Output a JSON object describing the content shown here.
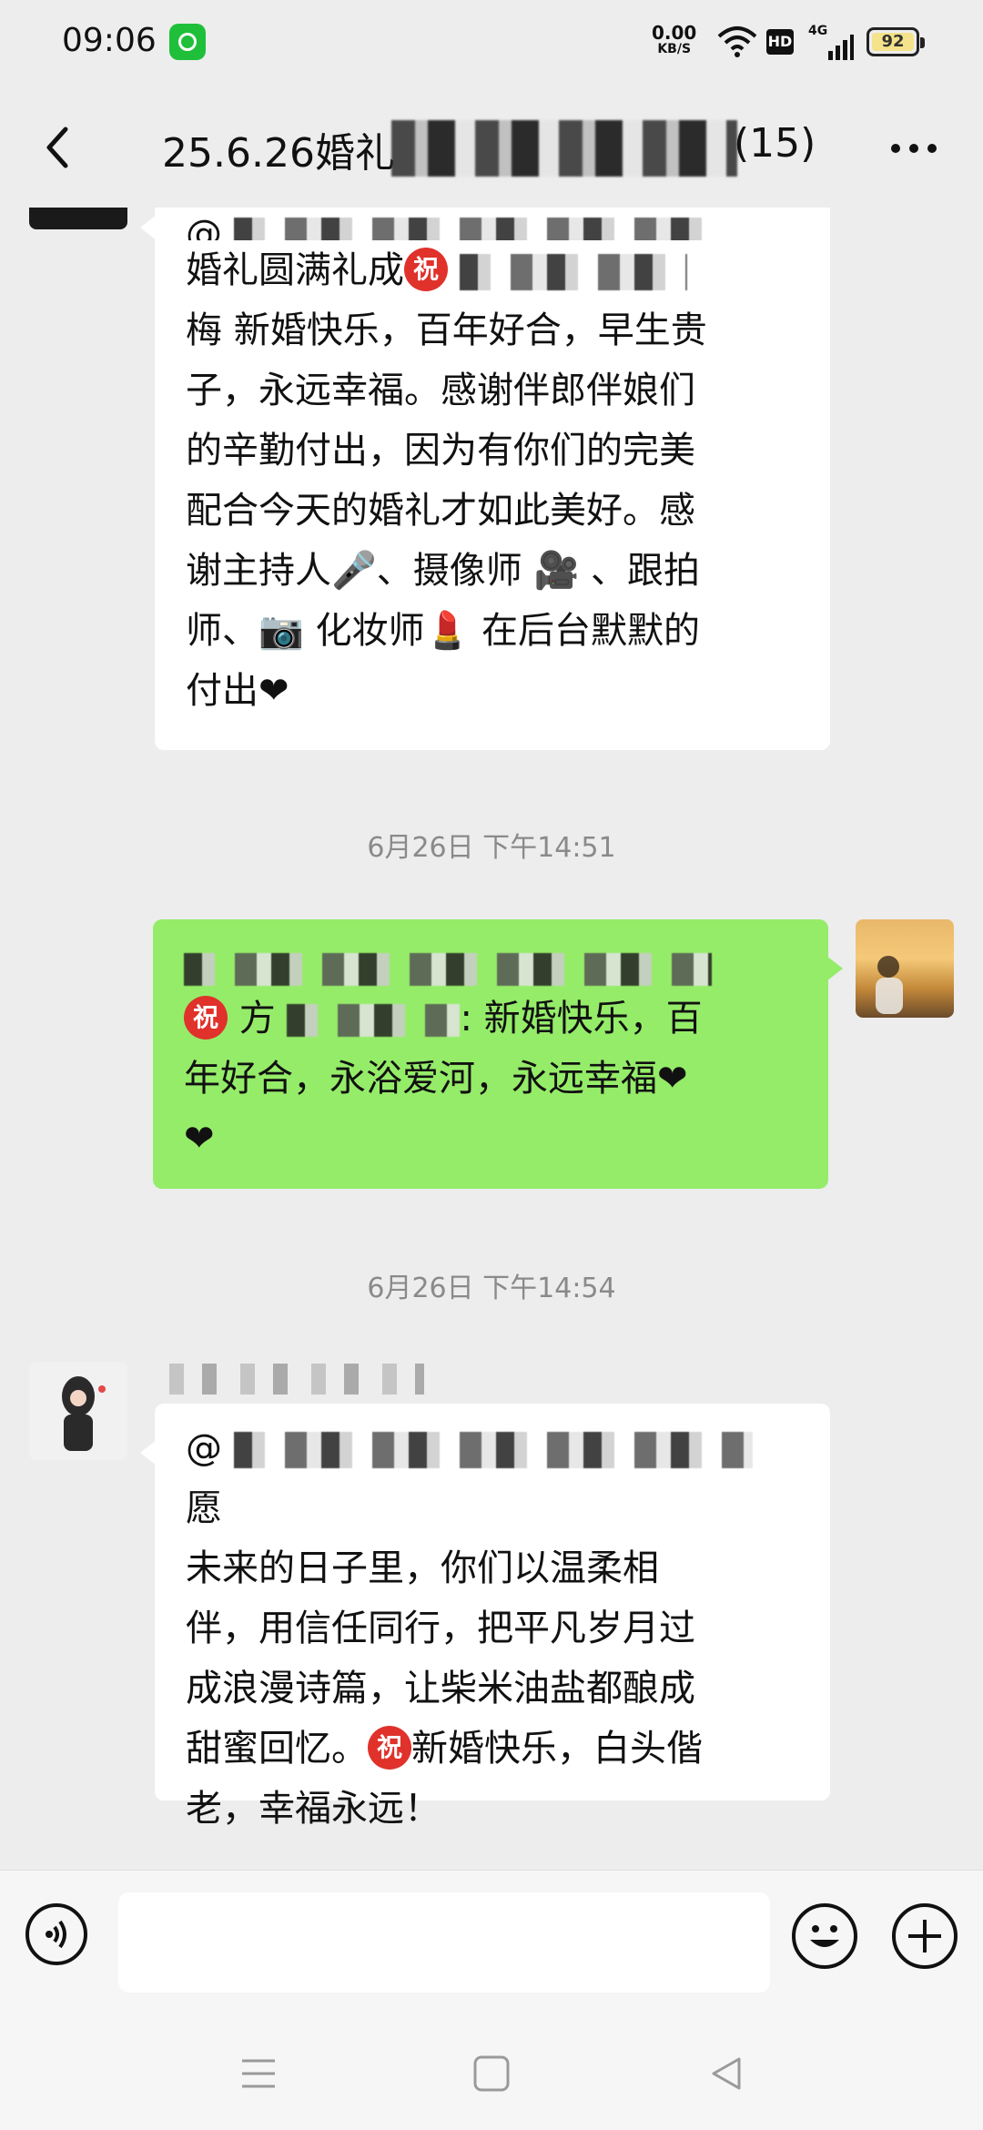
{
  "status_bar": {
    "time": "09:06",
    "net_speed_value": "0.00",
    "net_speed_unit": "KB/S",
    "hd_label": "HD",
    "network_type": "4G",
    "battery_level": "92"
  },
  "header": {
    "title_visible": "25.6.26婚礼",
    "member_count": "(15)"
  },
  "messages": {
    "m1": {
      "line0": "@",
      "line0b": "婚礼圆满礼成",
      "lines": [
        "梅 新婚快乐，百年好合，早生贵",
        "子，永远幸福。感谢伴郎伴娘们",
        "的辛勤付出，因为有你们的完美",
        "配合今天的婚礼才如此美好。感",
        "谢主持人🎤、摄像师 🎥 、跟拍",
        "师、📷 化妆师💄 在后台默默的",
        "付出❤"
      ]
    },
    "ts1": "6月26日 下午14:51",
    "m2": {
      "line1_prefix": "方",
      "line1_suffix": ": 新婚快乐，百",
      "line2": "年好合，永浴爱河，永远幸福❤",
      "line3": "❤"
    },
    "ts2": "6月26日 下午14:54",
    "m3": {
      "line1_prefix": "@",
      "line1_suffix": "愿",
      "lines": [
        "未来的日子里，你们以温柔相",
        "伴，用信任同行，把平凡岁月过",
        "成浪漫诗篇，让柴米油盐都酿成"
      ],
      "line5_prefix": "甜蜜回忆。",
      "line5_suffix": "新婚快乐，白头偕",
      "line6": "老，幸福永远！"
    },
    "zhu_glyph": "祝"
  },
  "input_bar": {
    "placeholder": ""
  },
  "icons": {
    "back": "back-arrow-icon",
    "more": "more-dots-icon",
    "voice": "voice-icon",
    "emoji": "emoji-icon",
    "plus": "plus-icon"
  },
  "colors": {
    "background": "#ededed",
    "own_bubble": "#95ec69",
    "other_bubble": "#ffffff",
    "zhu_badge": "#e0312b"
  }
}
